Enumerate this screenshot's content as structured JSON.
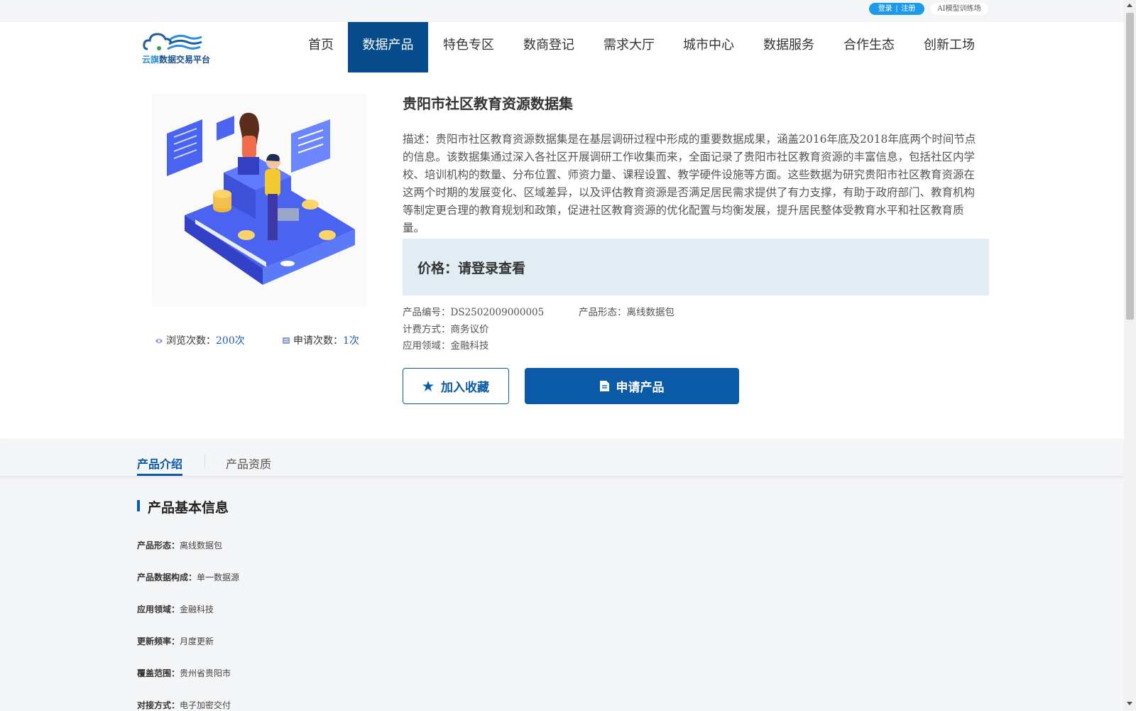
{
  "topbar": {
    "login": "登录",
    "divider": "|",
    "register": "注册",
    "ai_link": "AI模型训练场"
  },
  "logo": {
    "brand_a": "云旗",
    "brand_b": "数据交易平台"
  },
  "nav": [
    {
      "label": "首页",
      "active": false
    },
    {
      "label": "数据产品",
      "active": true
    },
    {
      "label": "特色专区",
      "active": false
    },
    {
      "label": "数商登记",
      "active": false
    },
    {
      "label": "需求大厅",
      "active": false
    },
    {
      "label": "城市中心",
      "active": false
    },
    {
      "label": "数据服务",
      "active": false
    },
    {
      "label": "合作生态",
      "active": false
    },
    {
      "label": "创新工场",
      "active": false
    }
  ],
  "product": {
    "title": "贵阳市社区教育资源数据集",
    "description": "描述：贵阳市社区教育资源数据集是在基层调研过程中形成的重要数据成果，涵盖2016年底及2018年底两个时间节点的信息。该数据集通过深入各社区开展调研工作收集而来，全面记录了贵阳市社区教育资源的丰富信息，包括社区内学校、培训机构的数量、分布位置、师资力量、课程设置、教学硬件设施等方面。这些数据为研究贵阳市社区教育资源在这两个时期的发展变化、区域差异，以及评估教育资源是否满足居民需求提供了有力支撑，有助于政府部门、教育机构等制定更合理的教育规划和政策，促进社区教育资源的优化配置与均衡发展，提升居民整体受教育水平和社区教育质量。",
    "price": "价格：请登录查看",
    "views_label": "浏览次数：",
    "views_value": "200次",
    "applies_label": "申请次数：",
    "applies_value": "1次",
    "code": "产品编号：DS2502009000005",
    "form": "产品形态：离线数据包",
    "billing": "计费方式：商务议价",
    "field": "应用领域：金融科技",
    "fav_button": "加入收藏",
    "apply_button": "申请产品"
  },
  "tabs": [
    {
      "label": "产品介绍",
      "active": true
    },
    {
      "label": "产品资质",
      "active": false
    }
  ],
  "basic_info": {
    "title": "产品基本信息",
    "rows": [
      {
        "key": "产品形态：",
        "value": "离线数据包"
      },
      {
        "key": "产品数据构成：",
        "value": "单一数据源"
      },
      {
        "key": "应用领域：",
        "value": "金融科技"
      },
      {
        "key": "更新频率：",
        "value": "月度更新"
      },
      {
        "key": "覆盖范围：",
        "value": "贵州省贵阳市"
      },
      {
        "key": "对接方式：",
        "value": "电子加密交付"
      }
    ]
  },
  "colors": {
    "primary": "#0a5aa8",
    "nav_active": "#064c8c",
    "price_bg": "#e2edf3",
    "pill": "#1e9be8"
  }
}
